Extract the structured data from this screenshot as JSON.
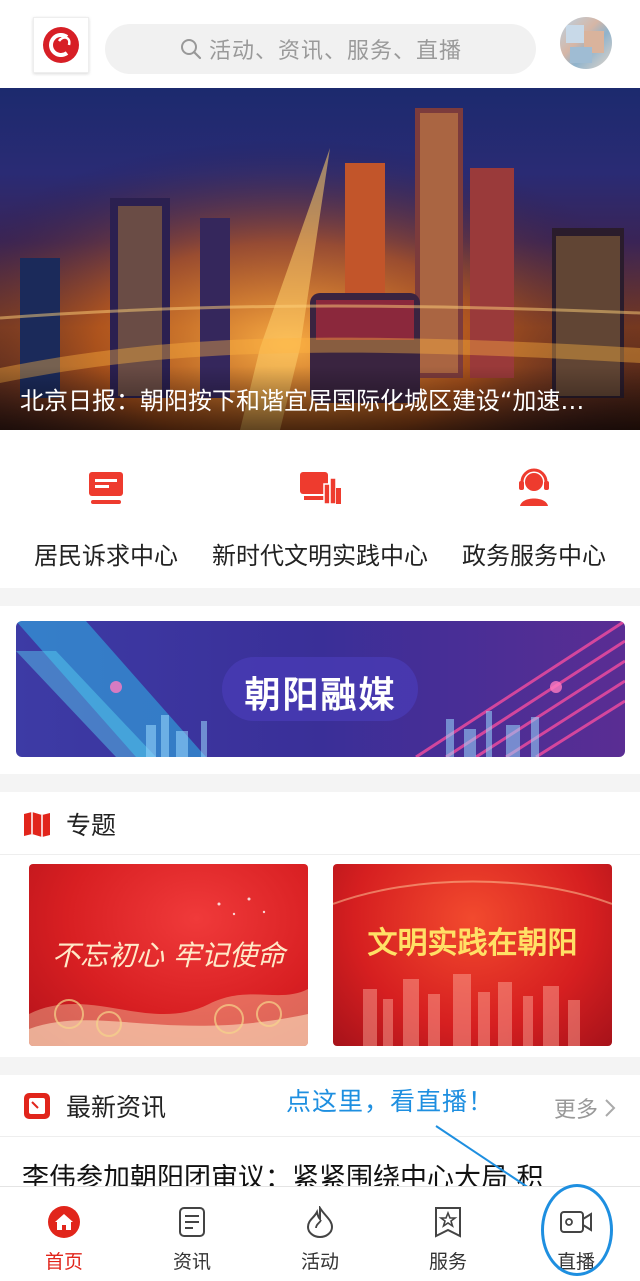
{
  "header": {
    "search_placeholder": "活动、资讯、服务、直播"
  },
  "banner": {
    "caption": "北京日报：朝阳按下和谐宜居国际化城区建设“加速…"
  },
  "services": [
    {
      "label": "居民诉求中心",
      "icon": "monitor-icon"
    },
    {
      "label": "新时代文明实践中心",
      "icon": "bar-chart-icon"
    },
    {
      "label": "政务服务中心",
      "icon": "headset-icon"
    }
  ],
  "promo": {
    "title": "朝阳融媒"
  },
  "topics": {
    "title": "专题",
    "cards": [
      {
        "text": "不忘初心 牢记使命"
      },
      {
        "text": "文明实践在朝阳"
      }
    ]
  },
  "news": {
    "title": "最新资讯",
    "more": "更多",
    "first_item": "李伟参加朝阳团审议：紧紧围绕中心大局 积"
  },
  "hint": "点这里，看直播！",
  "tabbar": [
    {
      "label": "首页",
      "icon": "home-icon",
      "active": true
    },
    {
      "label": "资讯",
      "icon": "document-icon",
      "active": false
    },
    {
      "label": "活动",
      "icon": "flame-icon",
      "active": false
    },
    {
      "label": "服务",
      "icon": "star-badge-icon",
      "active": false
    },
    {
      "label": "直播",
      "icon": "video-camera-icon",
      "active": false
    }
  ],
  "colors": {
    "brand_red": "#e1251b",
    "hint_blue": "#1e8fe0"
  }
}
